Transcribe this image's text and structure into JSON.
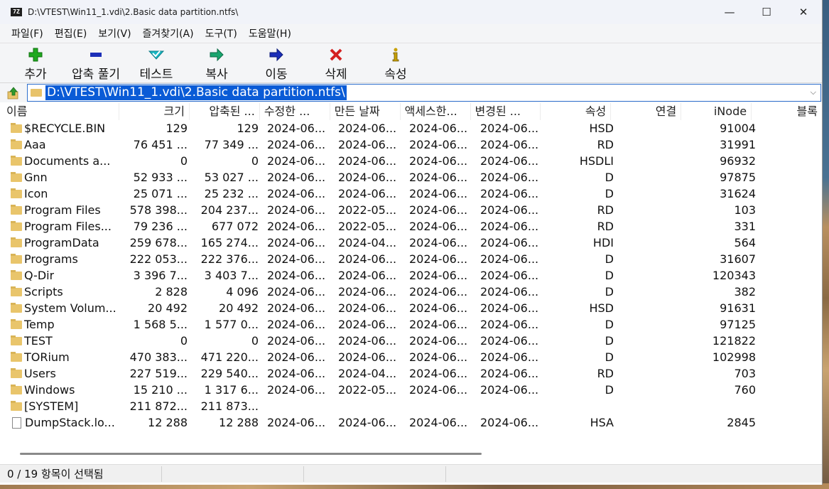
{
  "window": {
    "title": "D:\\VTEST\\Win11_1.vdi\\2.Basic data partition.ntfs\\",
    "app_icon_text": "7Z",
    "controls": {
      "minimize": "—",
      "maximize": "☐",
      "close": "✕"
    }
  },
  "menu": [
    "파일(F)",
    "편집(E)",
    "보기(V)",
    "즐겨찾기(A)",
    "도구(T)",
    "도움말(H)"
  ],
  "toolbar": [
    {
      "label": "추가",
      "icon": "plus-icon",
      "color": "#1fa91f"
    },
    {
      "label": "압축 풀기",
      "icon": "minus-icon",
      "color": "#1c2fb8"
    },
    {
      "label": "테스트",
      "icon": "check-icon",
      "color": "#19b8c4"
    },
    {
      "label": "복사",
      "icon": "copy-arrow-icon",
      "color": "#1aa56f"
    },
    {
      "label": "이동",
      "icon": "move-arrow-icon",
      "color": "#1c2fb8"
    },
    {
      "label": "삭제",
      "icon": "delete-x-icon",
      "color": "#d42020"
    },
    {
      "label": "속성",
      "icon": "info-icon",
      "color": "#c8a000"
    }
  ],
  "address": {
    "path": "D:\\VTEST\\Win11_1.vdi\\2.Basic data partition.ntfs\\"
  },
  "columns": [
    "이름",
    "크기",
    "압축된 ...",
    "수정한 ...",
    "만든 날짜",
    "액세스한...",
    "변경된 ...",
    "속성",
    "연결",
    "iNode",
    "블록"
  ],
  "files": [
    {
      "name": "$RECYCLE.BIN",
      "type": "folder",
      "size": "129",
      "packed": "129",
      "modified": "2024-06...",
      "created": "2024-06...",
      "accessed": "2024-06...",
      "changed": "2024-06...",
      "attr": "HSD",
      "links": "",
      "inode": "91004"
    },
    {
      "name": "Aaa",
      "type": "folder",
      "size": "76 451 ...",
      "packed": "77 349 ...",
      "modified": "2024-06...",
      "created": "2024-06...",
      "accessed": "2024-06...",
      "changed": "2024-06...",
      "attr": "RD",
      "links": "",
      "inode": "31991"
    },
    {
      "name": "Documents a...",
      "type": "folder",
      "size": "0",
      "packed": "0",
      "modified": "2024-06...",
      "created": "2024-06...",
      "accessed": "2024-06...",
      "changed": "2024-06...",
      "attr": "HSDLI",
      "links": "",
      "inode": "96932"
    },
    {
      "name": "Gnn",
      "type": "folder",
      "size": "52 933 ...",
      "packed": "53 027 ...",
      "modified": "2024-06...",
      "created": "2024-06...",
      "accessed": "2024-06...",
      "changed": "2024-06...",
      "attr": "D",
      "links": "",
      "inode": "97875"
    },
    {
      "name": "Icon",
      "type": "folder",
      "size": "25 071 ...",
      "packed": "25 232 ...",
      "modified": "2024-06...",
      "created": "2024-06...",
      "accessed": "2024-06...",
      "changed": "2024-06...",
      "attr": "D",
      "links": "",
      "inode": "31624"
    },
    {
      "name": "Program Files",
      "type": "folder",
      "size": "578 398...",
      "packed": "204 237...",
      "modified": "2024-06...",
      "created": "2022-05...",
      "accessed": "2024-06...",
      "changed": "2024-06...",
      "attr": "RD",
      "links": "",
      "inode": "103"
    },
    {
      "name": "Program Files...",
      "type": "folder",
      "size": "79 236 ...",
      "packed": "677 072",
      "modified": "2024-06...",
      "created": "2022-05...",
      "accessed": "2024-06...",
      "changed": "2024-06...",
      "attr": "RD",
      "links": "",
      "inode": "331"
    },
    {
      "name": "ProgramData",
      "type": "folder",
      "size": "259 678...",
      "packed": "165 274...",
      "modified": "2024-06...",
      "created": "2024-04...",
      "accessed": "2024-06...",
      "changed": "2024-06...",
      "attr": "HDI",
      "links": "",
      "inode": "564"
    },
    {
      "name": "Programs",
      "type": "folder",
      "size": "222 053...",
      "packed": "222 376...",
      "modified": "2024-06...",
      "created": "2024-06...",
      "accessed": "2024-06...",
      "changed": "2024-06...",
      "attr": "D",
      "links": "",
      "inode": "31607"
    },
    {
      "name": "Q-Dir",
      "type": "folder",
      "size": "3 396 7...",
      "packed": "3 403 7...",
      "modified": "2024-06...",
      "created": "2024-06...",
      "accessed": "2024-06...",
      "changed": "2024-06...",
      "attr": "D",
      "links": "",
      "inode": "120343"
    },
    {
      "name": "Scripts",
      "type": "folder",
      "size": "2 828",
      "packed": "4 096",
      "modified": "2024-06...",
      "created": "2024-06...",
      "accessed": "2024-06...",
      "changed": "2024-06...",
      "attr": "D",
      "links": "",
      "inode": "382"
    },
    {
      "name": "System Volum...",
      "type": "folder",
      "size": "20 492",
      "packed": "20 492",
      "modified": "2024-06...",
      "created": "2024-06...",
      "accessed": "2024-06...",
      "changed": "2024-06...",
      "attr": "HSD",
      "links": "",
      "inode": "91631"
    },
    {
      "name": "Temp",
      "type": "folder",
      "size": "1 568 5...",
      "packed": "1 577 0...",
      "modified": "2024-06...",
      "created": "2024-06...",
      "accessed": "2024-06...",
      "changed": "2024-06...",
      "attr": "D",
      "links": "",
      "inode": "97125"
    },
    {
      "name": "TEST",
      "type": "folder",
      "size": "0",
      "packed": "0",
      "modified": "2024-06...",
      "created": "2024-06...",
      "accessed": "2024-06...",
      "changed": "2024-06...",
      "attr": "D",
      "links": "",
      "inode": "121822"
    },
    {
      "name": "TORium",
      "type": "folder",
      "size": "470 383...",
      "packed": "471 220...",
      "modified": "2024-06...",
      "created": "2024-06...",
      "accessed": "2024-06...",
      "changed": "2024-06...",
      "attr": "D",
      "links": "",
      "inode": "102998"
    },
    {
      "name": "Users",
      "type": "folder",
      "size": "227 519...",
      "packed": "229 540...",
      "modified": "2024-06...",
      "created": "2024-04...",
      "accessed": "2024-06...",
      "changed": "2024-06...",
      "attr": "RD",
      "links": "",
      "inode": "703"
    },
    {
      "name": "Windows",
      "type": "folder",
      "size": "15 210 ...",
      "packed": "1 317 6...",
      "modified": "2024-06...",
      "created": "2022-05...",
      "accessed": "2024-06...",
      "changed": "2024-06...",
      "attr": "D",
      "links": "",
      "inode": "760"
    },
    {
      "name": "[SYSTEM]",
      "type": "folder",
      "size": "211 872...",
      "packed": "211 873...",
      "modified": "",
      "created": "",
      "accessed": "",
      "changed": "",
      "attr": "",
      "links": "",
      "inode": ""
    },
    {
      "name": "DumpStack.lo...",
      "type": "file",
      "size": "12 288",
      "packed": "12 288",
      "modified": "2024-06...",
      "created": "2024-06...",
      "accessed": "2024-06...",
      "changed": "2024-06...",
      "attr": "HSA",
      "links": "",
      "inode": "2845"
    }
  ],
  "status": {
    "selection": "0 / 19 항목이 선택됨",
    "pane2": "",
    "pane3": ""
  },
  "colors": {
    "selection": "#0a5bd6",
    "folder": "#e9c56b",
    "address_border": "#2e6fce"
  }
}
